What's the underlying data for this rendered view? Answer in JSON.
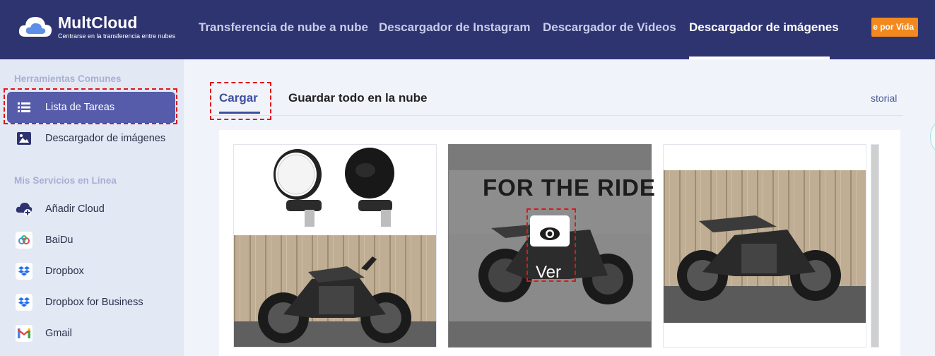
{
  "header": {
    "brand": "MultCloud",
    "tagline": "Centrarse en la transferencia entre nubes",
    "nav": [
      {
        "label": "Transferencia de nube a nube",
        "active": false
      },
      {
        "label": "Descargador de Instagram",
        "active": false
      },
      {
        "label": "Descargador de Videos",
        "active": false
      },
      {
        "label": "Descargador de imágenes",
        "active": true
      }
    ],
    "promo_label": "e por Vida"
  },
  "sidebar": {
    "section_common": "Herramientas Comunes",
    "common_items": [
      {
        "label": "Lista de Tareas",
        "icon": "list-icon",
        "active": true
      },
      {
        "label": "Descargador de imágenes",
        "icon": "image-icon",
        "active": false
      }
    ],
    "section_services": "Mis Servicios en Línea",
    "service_items": [
      {
        "label": "Añadir Cloud",
        "icon": "add-cloud-icon"
      },
      {
        "label": "BaiDu",
        "icon": "baidu-icon"
      },
      {
        "label": "Dropbox",
        "icon": "dropbox-icon"
      },
      {
        "label": "Dropbox for Business",
        "icon": "dropbox-business-icon"
      },
      {
        "label": "Gmail",
        "icon": "gmail-icon"
      }
    ]
  },
  "main": {
    "tabs": [
      {
        "label": "Cargar",
        "active": true
      },
      {
        "label": "Guardar todo en la nube",
        "active": false
      }
    ],
    "history_link": "storial",
    "images": [
      {
        "name": "mirrors-and-motorcycle"
      },
      {
        "name": "motorcycle-for-the-ride",
        "hovered": true,
        "banner_text": "FOR THE RIDE",
        "overlay_label": "Ver"
      },
      {
        "name": "motorcycle-wood-wall"
      }
    ]
  },
  "colors": {
    "topbar": "#2e3470",
    "sidebar_active": "#565caa",
    "promo": "#f2891f",
    "highlight": "#e01616",
    "accent": "#3f4f9f"
  }
}
